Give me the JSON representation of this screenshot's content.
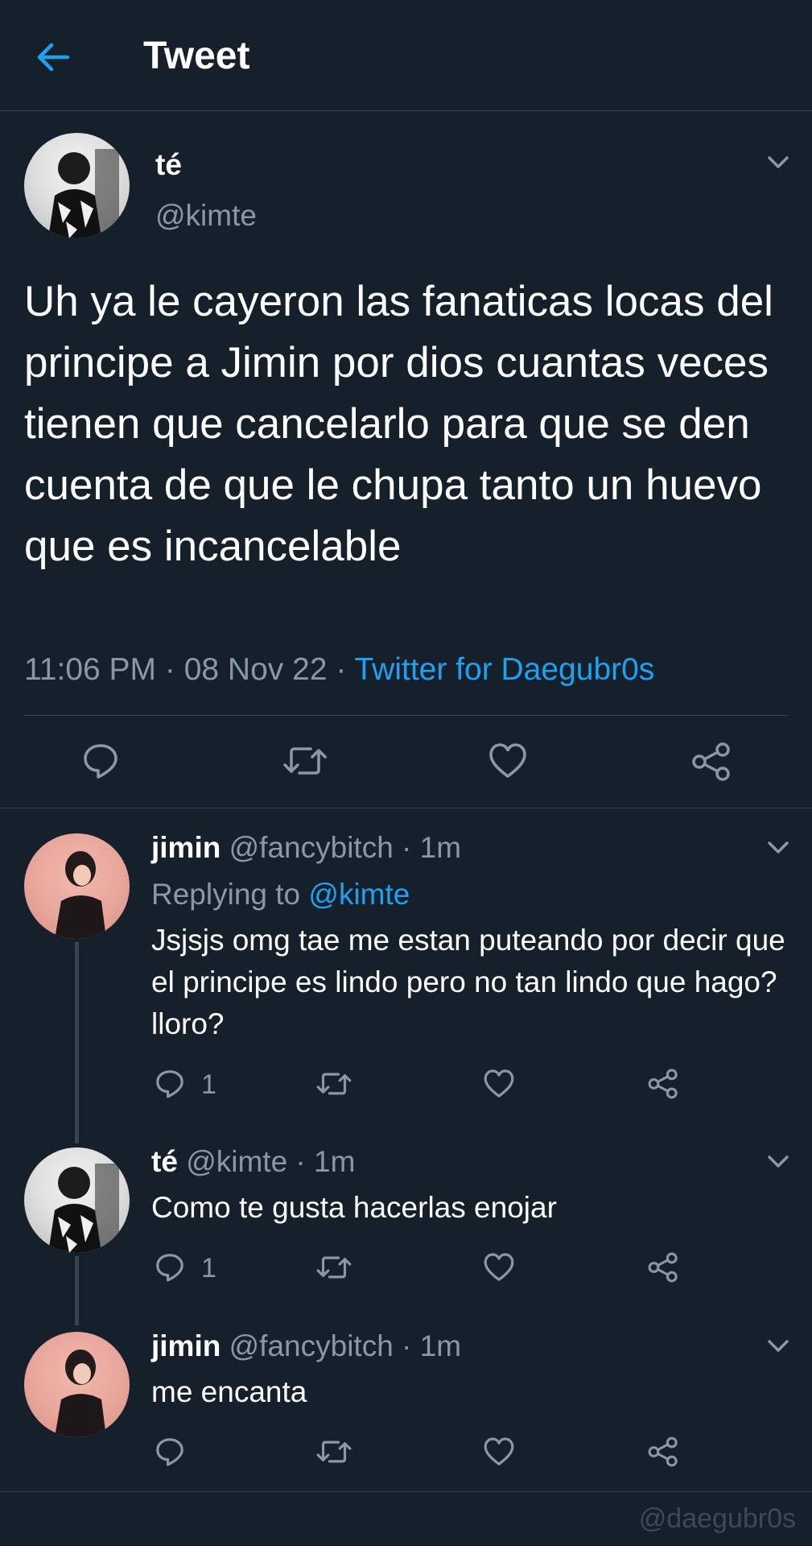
{
  "header": {
    "title": "Tweet",
    "back_icon": "arrow-left-icon"
  },
  "colors": {
    "background": "#15202b",
    "accent": "#1da1f2",
    "muted": "#8899a6",
    "divider": "#38444d"
  },
  "main_tweet": {
    "name": "té",
    "handle": "@kimte",
    "text": "Uh ya le cayeron las fanaticas locas del principe a Jimin por dios cuantas veces tienen que cancelarlo para que se den cuenta de que le chupa tanto un huevo que es incancelable",
    "time": "11:06 PM",
    "date": "08 Nov 22",
    "source": "Twitter for Daegubr0s"
  },
  "replies": [
    {
      "name": "jimin",
      "handle": "@fancybitch",
      "time": "1m",
      "replying_label": "Replying to",
      "replying_to": "@kimte",
      "text": "Jsjsjs omg tae me estan puteando por decir que el principe es lindo pero no tan lindo que hago? lloro?",
      "reply_count": "1"
    },
    {
      "name": "té",
      "handle": "@kimte",
      "time": "1m",
      "text": "Como te gusta hacerlas enojar",
      "reply_count": "1"
    },
    {
      "name": "jimin",
      "handle": "@fancybitch",
      "time": "1m",
      "text": "me encanta"
    }
  ],
  "watermark": "@daegubr0s"
}
